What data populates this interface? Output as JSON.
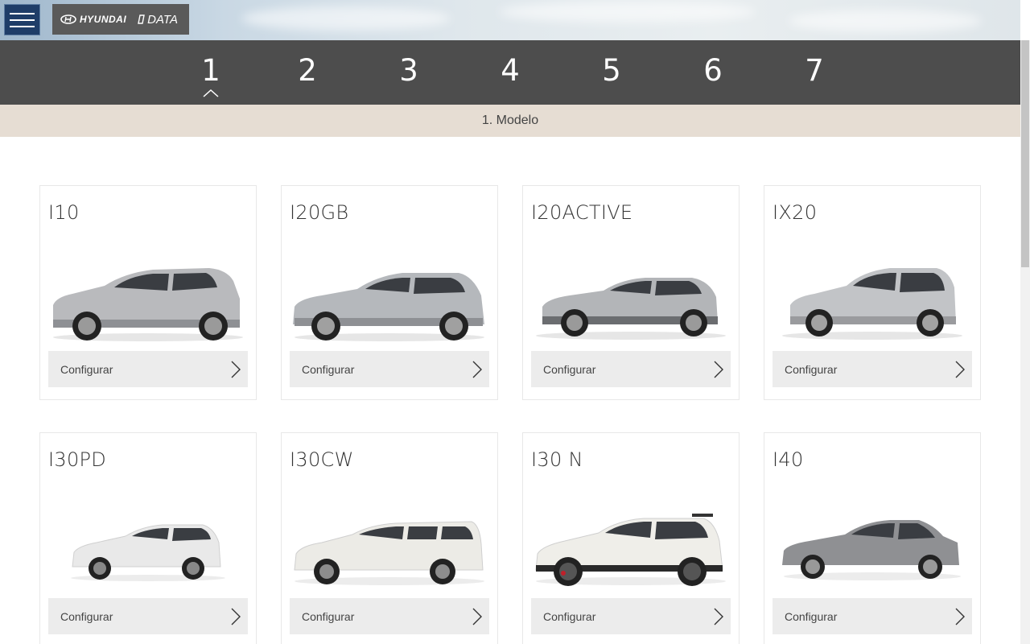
{
  "header": {
    "menu_icon": "hamburger-icon",
    "brand": {
      "logo_text": "HYUNDAI",
      "data_text": "DATA"
    }
  },
  "steps": {
    "items": [
      "1",
      "2",
      "3",
      "4",
      "5",
      "6",
      "7"
    ],
    "active": "1",
    "current_label": "1. Modelo"
  },
  "models": [
    {
      "name": "I10",
      "button": "Configurar",
      "color": "#b9babd"
    },
    {
      "name": "I20GB",
      "button": "Configurar",
      "color": "#b5b8bc"
    },
    {
      "name": "I20ACTIVE",
      "button": "Configurar",
      "color": "#b3b5b8"
    },
    {
      "name": "IX20",
      "button": "Configurar",
      "color": "#c2c4c7"
    },
    {
      "name": "I30PD",
      "button": "Configurar",
      "color": "#e9e9e9"
    },
    {
      "name": "I30CW",
      "button": "Configurar",
      "color": "#ecebe6"
    },
    {
      "name": "I30 N",
      "button": "Configurar",
      "color": "#efeee9"
    },
    {
      "name": "I40",
      "button": "Configurar",
      "color": "#8f9093"
    }
  ]
}
